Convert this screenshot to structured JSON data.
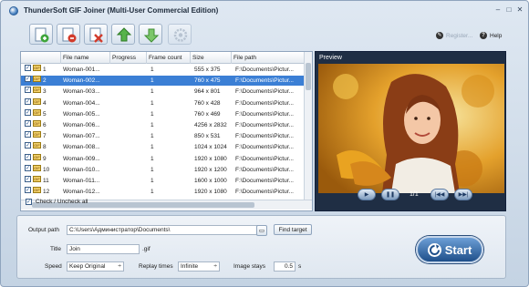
{
  "window": {
    "title": "ThunderSoft GIF Joiner (Multi-User Commercial Edition)"
  },
  "toolbar": {
    "register_label": "Register...",
    "help_label": "Help"
  },
  "file_list": {
    "columns": [
      "File name",
      "Progress",
      "Frame count",
      "Size",
      "File path"
    ],
    "rows": [
      {
        "num": "1",
        "name": "Woman-001...",
        "progress": "",
        "frames": "1",
        "size": "555 x 375",
        "path": "F:\\Documents\\Pictur..."
      },
      {
        "num": "2",
        "name": "Woman-002...",
        "progress": "",
        "frames": "1",
        "size": "760 x 475",
        "path": "F:\\Documents\\Pictur..."
      },
      {
        "num": "3",
        "name": "Woman-003...",
        "progress": "",
        "frames": "1",
        "size": "964 x 801",
        "path": "F:\\Documents\\Pictur..."
      },
      {
        "num": "4",
        "name": "Woman-004...",
        "progress": "",
        "frames": "1",
        "size": "760 x 428",
        "path": "F:\\Documents\\Pictur..."
      },
      {
        "num": "5",
        "name": "Woman-005...",
        "progress": "",
        "frames": "1",
        "size": "760 x 469",
        "path": "F:\\Documents\\Pictur..."
      },
      {
        "num": "6",
        "name": "Woman-006...",
        "progress": "",
        "frames": "1",
        "size": "4256 x 2832",
        "path": "F:\\Documents\\Pictur..."
      },
      {
        "num": "7",
        "name": "Woman-007...",
        "progress": "",
        "frames": "1",
        "size": "850 x 531",
        "path": "F:\\Documents\\Pictur..."
      },
      {
        "num": "8",
        "name": "Woman-008...",
        "progress": "",
        "frames": "1",
        "size": "1024 x 1024",
        "path": "F:\\Documents\\Pictur..."
      },
      {
        "num": "9",
        "name": "Woman-009...",
        "progress": "",
        "frames": "1",
        "size": "1920 x 1080",
        "path": "F:\\Documents\\Pictur..."
      },
      {
        "num": "10",
        "name": "Woman-010...",
        "progress": "",
        "frames": "1",
        "size": "1920 x 1200",
        "path": "F:\\Documents\\Pictur..."
      },
      {
        "num": "11",
        "name": "Woman-011...",
        "progress": "",
        "frames": "1",
        "size": "1600 x 1000",
        "path": "F:\\Documents\\Pictur..."
      },
      {
        "num": "12",
        "name": "Woman-012...",
        "progress": "",
        "frames": "1",
        "size": "1920 x 1080",
        "path": "F:\\Documents\\Pictur..."
      }
    ],
    "selected_row": 1,
    "check_all_label": "Check / Uncheck all"
  },
  "preview": {
    "label": "Preview",
    "page": "1/1"
  },
  "output": {
    "path_label": "Output path",
    "path_value": "C:\\Users\\Администратор\\Documents\\",
    "find_target_label": "Find target",
    "title_label": "Title",
    "title_value": "Join",
    "extension": ".gif",
    "speed_label": "Speed",
    "speed_value": "Keep Original",
    "replay_label": "Replay times",
    "replay_value": "Infinite",
    "stays_label": "Image stays",
    "stays_value": "0.5",
    "stays_unit": "s",
    "start_label": "Start"
  },
  "colors": {
    "selection": "#3b7fd5",
    "preview_bg": "#1f2e44",
    "start_button": "#1f4f8a",
    "accent_blue": "#2b5f9b"
  },
  "icons": [
    "app-icon",
    "add-file-icon",
    "remove-file-icon",
    "clear-list-icon",
    "move-up-icon",
    "move-down-icon",
    "settings-icon",
    "register-icon",
    "help-icon",
    "gif-file-icon",
    "play-icon",
    "pause-icon",
    "first-frame-icon",
    "last-frame-icon",
    "folder-icon",
    "start-icon"
  ]
}
